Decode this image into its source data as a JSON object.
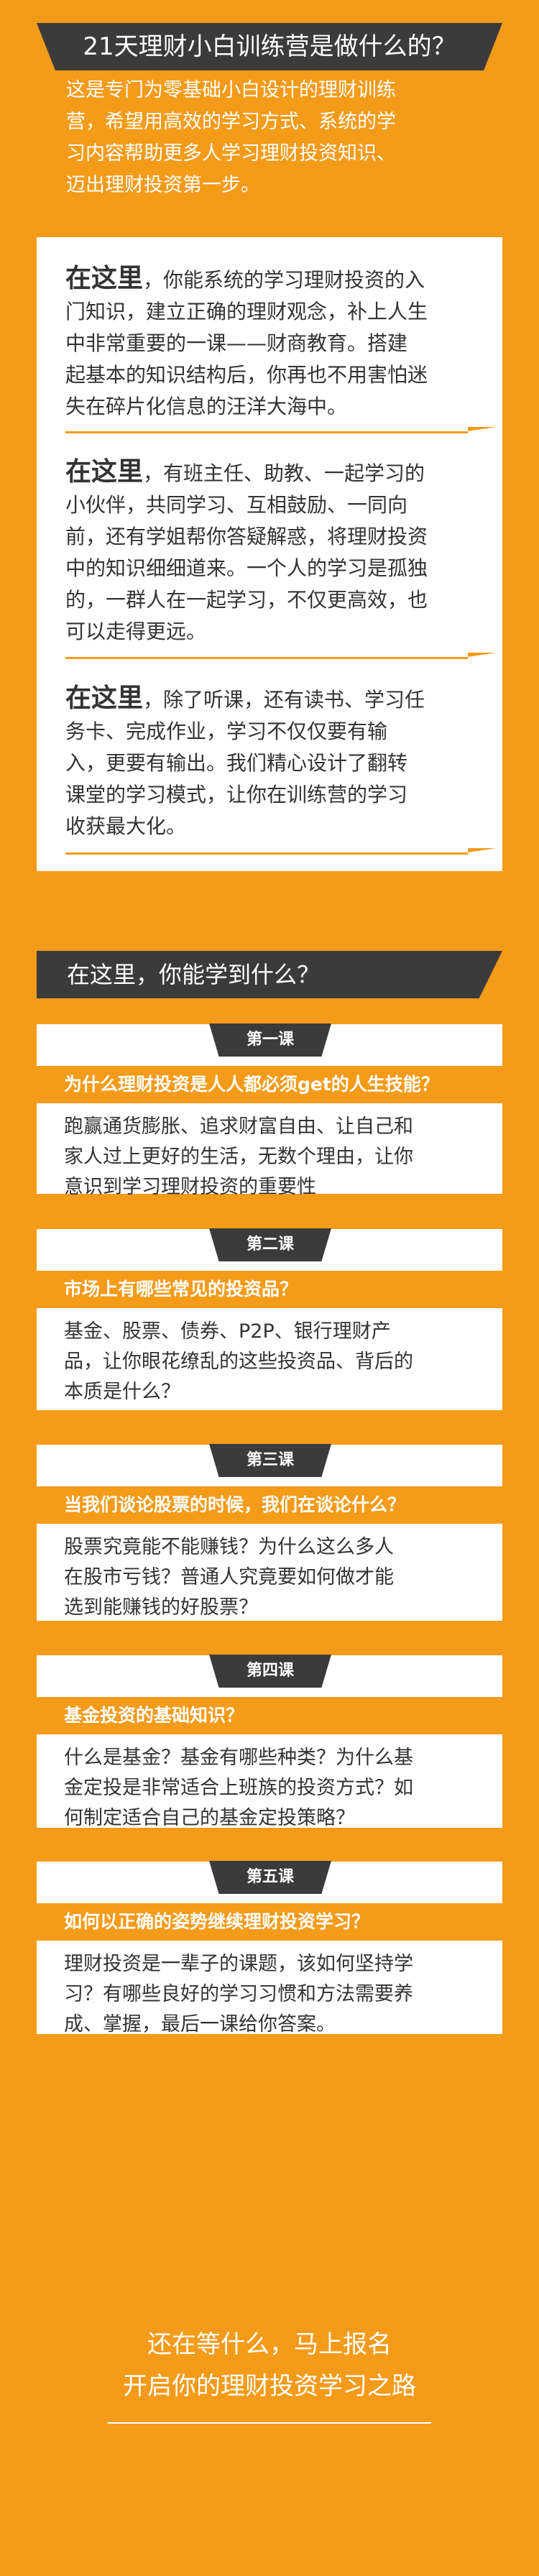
{
  "intro": {
    "title": "21天理财小白训练营是做什么的？",
    "lines": [
      "这是专门为零基础小白设计的理财训练",
      "营，希望用高效的学习方式、系统的学",
      "习内容帮助更多人学习理财投资知识、",
      "迈出理财投资第一步。"
    ]
  },
  "features": [
    {
      "lead": "在这里",
      "lines": [
        "，你能系统的学习理财投资的入",
        "门知识，建立正确的理财观念，补上人生",
        "中非常重要的一课——财商教育。搭建",
        "起基本的知识结构后，你再也不用害怕迷",
        "失在碎片化信息的汪洋大海中。"
      ]
    },
    {
      "lead": "在这里",
      "lines": [
        "，有班主任、助教、一起学习的",
        "小伙伴，共同学习、互相鼓励、一同向",
        "前，还有学姐帮你答疑解惑，将理财投资",
        "中的知识细细道来。一个人的学习是孤独",
        "的，一群人在一起学习，不仅更高效，也",
        "可以走得更远。"
      ]
    },
    {
      "lead": "在这里",
      "lines": [
        "，除了听课，还有读书、学习任",
        "务卡、完成作业，学习不仅仅要有输",
        "入，更要有输出。我们精心设计了翻转",
        "课堂的学习模式，让你在训练营的学习",
        "收获最大化。"
      ]
    }
  ],
  "learn": {
    "title": "在这里，你能学到什么？",
    "lessons": [
      {
        "tag": "第一课",
        "question": "为什么理财投资是人人都必须get的人生技能？",
        "answer_lines": [
          "跑赢通货膨胀、追求财富自由、让自己和",
          "家人过上更好的生活，无数个理由，让你",
          "意识到学习理财投资的重要性"
        ]
      },
      {
        "tag": "第二课",
        "question": "市场上有哪些常见的投资品？",
        "answer_lines": [
          "基金、股票、债券、P2P、银行理财产",
          "品，让你眼花缭乱的这些投资品、背后的",
          "本质是什么？"
        ]
      },
      {
        "tag": "第三课",
        "question": "当我们谈论股票的时候，我们在谈论什么？",
        "answer_lines": [
          "股票究竟能不能赚钱？为什么这么多人",
          "在股市亏钱？普通人究竟要如何做才能",
          "选到能赚钱的好股票？"
        ]
      },
      {
        "tag": "第四课",
        "question": "基金投资的基础知识？",
        "answer_lines": [
          "什么是基金？基金有哪些种类？为什么基",
          "金定投是非常适合上班族的投资方式？如",
          "何制定适合自己的基金定投策略？"
        ]
      },
      {
        "tag": "第五课",
        "question": "如何以正确的姿势继续理财投资学习？",
        "answer_lines": [
          "理财投资是一辈子的课题，该如何坚持学",
          "习？有哪些良好的学习习惯和方法需要养",
          "成、掌握，最后一课给你答案。"
        ]
      }
    ]
  },
  "cta": {
    "line1": "还在等什么，马上报名",
    "line2": "开启你的理财投资学习之路"
  }
}
